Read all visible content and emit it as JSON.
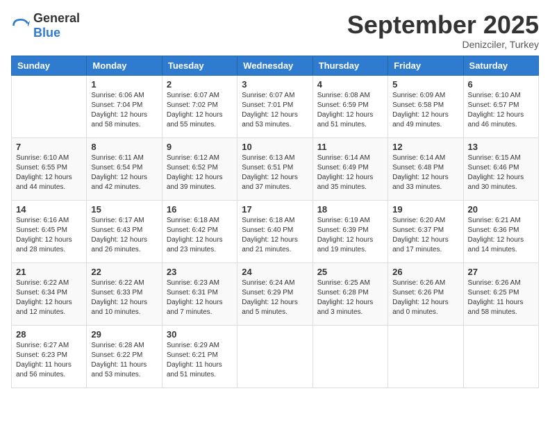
{
  "header": {
    "logo_general": "General",
    "logo_blue": "Blue",
    "month": "September 2025",
    "location": "Denizciler, Turkey"
  },
  "days_of_week": [
    "Sunday",
    "Monday",
    "Tuesday",
    "Wednesday",
    "Thursday",
    "Friday",
    "Saturday"
  ],
  "weeks": [
    [
      {
        "day": "",
        "info": ""
      },
      {
        "day": "1",
        "info": "Sunrise: 6:06 AM\nSunset: 7:04 PM\nDaylight: 12 hours and 58 minutes."
      },
      {
        "day": "2",
        "info": "Sunrise: 6:07 AM\nSunset: 7:02 PM\nDaylight: 12 hours and 55 minutes."
      },
      {
        "day": "3",
        "info": "Sunrise: 6:07 AM\nSunset: 7:01 PM\nDaylight: 12 hours and 53 minutes."
      },
      {
        "day": "4",
        "info": "Sunrise: 6:08 AM\nSunset: 6:59 PM\nDaylight: 12 hours and 51 minutes."
      },
      {
        "day": "5",
        "info": "Sunrise: 6:09 AM\nSunset: 6:58 PM\nDaylight: 12 hours and 49 minutes."
      },
      {
        "day": "6",
        "info": "Sunrise: 6:10 AM\nSunset: 6:57 PM\nDaylight: 12 hours and 46 minutes."
      }
    ],
    [
      {
        "day": "7",
        "info": "Sunrise: 6:10 AM\nSunset: 6:55 PM\nDaylight: 12 hours and 44 minutes."
      },
      {
        "day": "8",
        "info": "Sunrise: 6:11 AM\nSunset: 6:54 PM\nDaylight: 12 hours and 42 minutes."
      },
      {
        "day": "9",
        "info": "Sunrise: 6:12 AM\nSunset: 6:52 PM\nDaylight: 12 hours and 39 minutes."
      },
      {
        "day": "10",
        "info": "Sunrise: 6:13 AM\nSunset: 6:51 PM\nDaylight: 12 hours and 37 minutes."
      },
      {
        "day": "11",
        "info": "Sunrise: 6:14 AM\nSunset: 6:49 PM\nDaylight: 12 hours and 35 minutes."
      },
      {
        "day": "12",
        "info": "Sunrise: 6:14 AM\nSunset: 6:48 PM\nDaylight: 12 hours and 33 minutes."
      },
      {
        "day": "13",
        "info": "Sunrise: 6:15 AM\nSunset: 6:46 PM\nDaylight: 12 hours and 30 minutes."
      }
    ],
    [
      {
        "day": "14",
        "info": "Sunrise: 6:16 AM\nSunset: 6:45 PM\nDaylight: 12 hours and 28 minutes."
      },
      {
        "day": "15",
        "info": "Sunrise: 6:17 AM\nSunset: 6:43 PM\nDaylight: 12 hours and 26 minutes."
      },
      {
        "day": "16",
        "info": "Sunrise: 6:18 AM\nSunset: 6:42 PM\nDaylight: 12 hours and 23 minutes."
      },
      {
        "day": "17",
        "info": "Sunrise: 6:18 AM\nSunset: 6:40 PM\nDaylight: 12 hours and 21 minutes."
      },
      {
        "day": "18",
        "info": "Sunrise: 6:19 AM\nSunset: 6:39 PM\nDaylight: 12 hours and 19 minutes."
      },
      {
        "day": "19",
        "info": "Sunrise: 6:20 AM\nSunset: 6:37 PM\nDaylight: 12 hours and 17 minutes."
      },
      {
        "day": "20",
        "info": "Sunrise: 6:21 AM\nSunset: 6:36 PM\nDaylight: 12 hours and 14 minutes."
      }
    ],
    [
      {
        "day": "21",
        "info": "Sunrise: 6:22 AM\nSunset: 6:34 PM\nDaylight: 12 hours and 12 minutes."
      },
      {
        "day": "22",
        "info": "Sunrise: 6:22 AM\nSunset: 6:33 PM\nDaylight: 12 hours and 10 minutes."
      },
      {
        "day": "23",
        "info": "Sunrise: 6:23 AM\nSunset: 6:31 PM\nDaylight: 12 hours and 7 minutes."
      },
      {
        "day": "24",
        "info": "Sunrise: 6:24 AM\nSunset: 6:29 PM\nDaylight: 12 hours and 5 minutes."
      },
      {
        "day": "25",
        "info": "Sunrise: 6:25 AM\nSunset: 6:28 PM\nDaylight: 12 hours and 3 minutes."
      },
      {
        "day": "26",
        "info": "Sunrise: 6:26 AM\nSunset: 6:26 PM\nDaylight: 12 hours and 0 minutes."
      },
      {
        "day": "27",
        "info": "Sunrise: 6:26 AM\nSunset: 6:25 PM\nDaylight: 11 hours and 58 minutes."
      }
    ],
    [
      {
        "day": "28",
        "info": "Sunrise: 6:27 AM\nSunset: 6:23 PM\nDaylight: 11 hours and 56 minutes."
      },
      {
        "day": "29",
        "info": "Sunrise: 6:28 AM\nSunset: 6:22 PM\nDaylight: 11 hours and 53 minutes."
      },
      {
        "day": "30",
        "info": "Sunrise: 6:29 AM\nSunset: 6:21 PM\nDaylight: 11 hours and 51 minutes."
      },
      {
        "day": "",
        "info": ""
      },
      {
        "day": "",
        "info": ""
      },
      {
        "day": "",
        "info": ""
      },
      {
        "day": "",
        "info": ""
      }
    ]
  ]
}
